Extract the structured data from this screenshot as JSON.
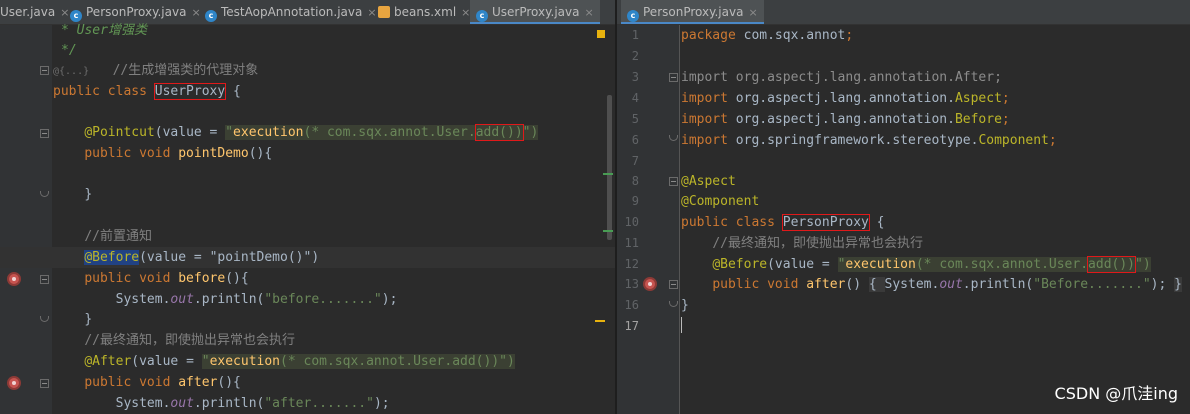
{
  "left_tabs": [
    {
      "label": "User.java",
      "icon": "class-icon"
    },
    {
      "label": "PersonProxy.java",
      "icon": "class-icon"
    },
    {
      "label": "TestAopAnnotation.java",
      "icon": "class-icon"
    },
    {
      "label": "beans.xml",
      "icon": "xml-icon"
    },
    {
      "label": "UserProxy.java",
      "icon": "class-icon"
    }
  ],
  "right_tabs": [
    {
      "label": "PersonProxy.java",
      "icon": "class-icon"
    }
  ],
  "left_code": {
    "l1_doc": "* User增强类",
    "l2_doc": "*/",
    "l3_fold": "@{...}",
    "l3_comment": "//生成增强类的代理对象",
    "l4_kw": "public class ",
    "l4_name": "UserProxy",
    "l4_rest": " {",
    "l6_ann": "@Pointcut",
    "l6_a": "(value = ",
    "l6_q": "\"",
    "l6_exec": "execution",
    "l6_b": "(* com.sqx.annot.User.",
    "l6_boxed": "add())",
    "l6_end": "\")",
    "l7_kw": "public void ",
    "l7_fn": "pointDemo",
    "l7_rest": "(){",
    "l9_close": "}",
    "l11_comment": "//前置通知",
    "l12_ann": "@Before",
    "l12_a": "(value = ",
    "l12_str": "\"pointDemo()\"",
    "l12_end": ")",
    "l13_kw": "public void ",
    "l13_fn": "before",
    "l13_rest": "(){",
    "l14_a": "System.",
    "l14_out": "out",
    "l14_b": ".println(",
    "l14_str": "\"before.......\"",
    "l14_end": ");",
    "l15_close": "}",
    "l16_comment": "//最终通知，即使抛出异常也会执行",
    "l17_ann": "@After",
    "l17_a": "(value = ",
    "l17_q": "\"",
    "l17_exec": "execution",
    "l17_b": "(* com.sqx.annot.User.add())",
    "l17_end": "\")",
    "l18_kw": "public void ",
    "l18_fn": "after",
    "l18_rest": "(){",
    "l19_a": "System.",
    "l19_out": "out",
    "l19_b": ".println(",
    "l19_str": "\"after.......\"",
    "l19_end": ");"
  },
  "right_line_numbers": [
    "1",
    "2",
    "3",
    "4",
    "5",
    "6",
    "7",
    "8",
    "9",
    "10",
    "11",
    "12",
    "13",
    "16",
    "17"
  ],
  "right_code": {
    "r1_kw": "package ",
    "r1_rest": "com.sqx.annot",
    "r1_end": ";",
    "r3_kw": "import ",
    "r3_rest": "org.aspectj.lang.annotation.After",
    "r3_end": ";",
    "r4_kw": "import ",
    "r4_rest": "org.aspectj.lang.annotation.",
    "r4_cls": "Aspect",
    "r4_end": ";",
    "r5_kw": "import ",
    "r5_rest": "org.aspectj.lang.annotation.",
    "r5_cls": "Before",
    "r5_end": ";",
    "r6_kw": "import ",
    "r6_rest": "org.springframework.stereotype.",
    "r6_cls": "Component",
    "r6_end": ";",
    "r8_ann": "@Aspect",
    "r9_ann": "@Component",
    "r10_kw": "public class ",
    "r10_name": "PersonProxy",
    "r10_rest": " {",
    "r11_comment": "//最终通知，即使抛出异常也会执行",
    "r12_ann": "@Before",
    "r12_a": "(value = ",
    "r12_q": "\"",
    "r12_exec": "execution",
    "r12_b": "(* com.sqx.annot.Use",
    "r12_c": "r.",
    "r12_boxed": "add())",
    "r12_end": "\")",
    "r13_kw": "public void ",
    "r13_fn": "after",
    "r13_a": "() ",
    "r13_ob": "{ ",
    "r13_b": "System.",
    "r13_out": "out",
    "r13_c": ".println(",
    "r13_str": "\"Before.......\"",
    "r13_end": "); ",
    "r13_cb": "}",
    "r16_close": "}"
  },
  "watermark": "CSDN @爪洼ing"
}
